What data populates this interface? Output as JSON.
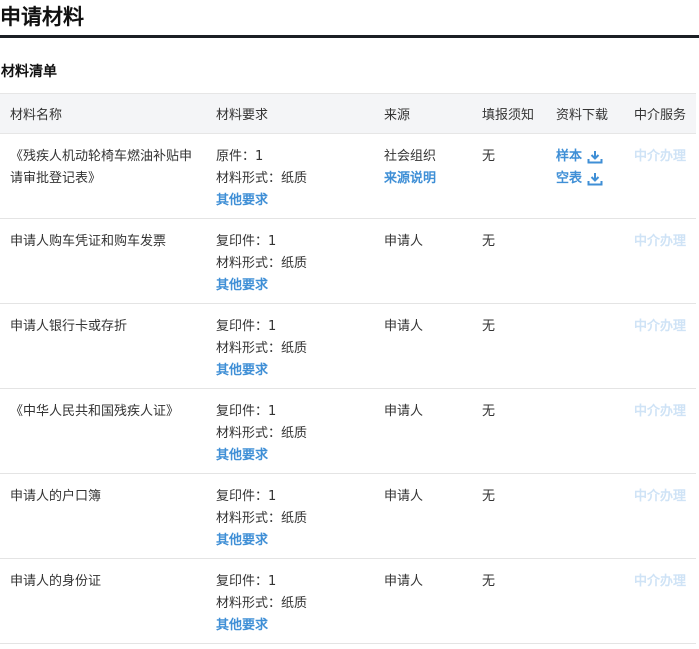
{
  "page": {
    "title": "申请材料"
  },
  "section": {
    "title": "材料清单"
  },
  "table": {
    "headers": [
      "材料名称",
      "材料要求",
      "来源",
      "填报须知",
      "资料下载",
      "中介服务"
    ],
    "rows": [
      {
        "name": "《残疾人机动轮椅车燃油补贴申请审批登记表》",
        "req_count": "原件：1",
        "req_form": "材料形式：纸质",
        "req_more": "其他要求",
        "source": "社会组织",
        "source_note": "来源说明",
        "notice": "无",
        "downloads": [
          "样本",
          "空表"
        ],
        "service": "中介办理"
      },
      {
        "name": "申请人购车凭证和购车发票",
        "req_count": "复印件：1",
        "req_form": "材料形式：纸质",
        "req_more": "其他要求",
        "source": "申请人",
        "notice": "无",
        "service": "中介办理"
      },
      {
        "name": "申请人银行卡或存折",
        "req_count": "复印件：1",
        "req_form": "材料形式：纸质",
        "req_more": "其他要求",
        "source": "申请人",
        "notice": "无",
        "service": "中介办理"
      },
      {
        "name": "《中华人民共和国残疾人证》",
        "req_count": "复印件：1",
        "req_form": "材料形式：纸质",
        "req_more": "其他要求",
        "source": "申请人",
        "notice": "无",
        "service": "中介办理"
      },
      {
        "name": "申请人的户口簿",
        "req_count": "复印件：1",
        "req_form": "材料形式：纸质",
        "req_more": "其他要求",
        "source": "申请人",
        "notice": "无",
        "service": "中介办理"
      },
      {
        "name": "申请人的身份证",
        "req_count": "复印件：1",
        "req_form": "材料形式：纸质",
        "req_more": "其他要求",
        "source": "申请人",
        "notice": "无",
        "service": "中介办理"
      }
    ]
  },
  "colors": {
    "link": "#3f8fd6",
    "disabled_link": "#cfe3f6",
    "header_rule": "#1b1f24",
    "header_bg": "#f4f5f7"
  },
  "icons": {
    "download": "download-icon"
  }
}
